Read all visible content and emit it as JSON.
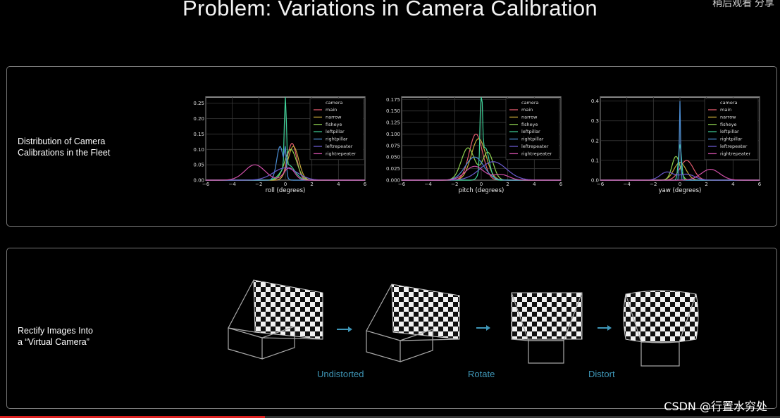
{
  "slide": {
    "title": "Problem: Variations in Camera Calibration",
    "top_right": "稍后观看 分享"
  },
  "section1": {
    "label_line1": "Distribution of Camera",
    "label_line2": "Calibrations in the Fleet"
  },
  "section2": {
    "label_line1": "Rectify Images Into",
    "label_line2": "a “Virtual Camera”",
    "steps": [
      "Undistorted",
      "Rotate",
      "Distort"
    ]
  },
  "watermark": "CSDN @行置水穷处",
  "video": {
    "progress": 0.34
  },
  "legend_title": "camera",
  "chart_data": [
    {
      "type": "line",
      "xlabel": "roll (degrees)",
      "xlim": [
        -6,
        6
      ],
      "ylim": [
        0,
        0.27
      ],
      "xticks": [
        -6,
        -4,
        -2,
        0,
        2,
        4,
        6
      ],
      "yticks": [
        0.0,
        0.05,
        0.1,
        0.15,
        0.2,
        0.25
      ],
      "legend_title": "camera",
      "series": [
        {
          "name": "main",
          "color": "#e05a6d",
          "peaks": [
            [
              0.5,
              0.12,
              0.35
            ]
          ]
        },
        {
          "name": "narrow",
          "color": "#c5a83a",
          "peaks": [
            [
              0.6,
              0.11,
              0.4
            ]
          ]
        },
        {
          "name": "fisheye",
          "color": "#8fd14f",
          "peaks": [
            [
              0.4,
              0.1,
              0.45
            ]
          ]
        },
        {
          "name": "leftpillar",
          "color": "#3fd39a",
          "peaks": [
            [
              0.0,
              0.26,
              0.07
            ],
            [
              0.2,
              0.05,
              0.5
            ]
          ]
        },
        {
          "name": "rightpillar",
          "color": "#4c8fd6",
          "peaks": [
            [
              -0.4,
              0.11,
              0.25
            ],
            [
              0.0,
              0.08,
              0.07
            ]
          ]
        },
        {
          "name": "leftrepeater",
          "color": "#6a5acd",
          "peaks": [
            [
              0.0,
              0.04,
              0.9
            ]
          ]
        },
        {
          "name": "rightrepeater",
          "color": "#d04fa8",
          "peaks": [
            [
              -2.3,
              0.05,
              0.75
            ],
            [
              0.3,
              0.04,
              0.4
            ]
          ]
        }
      ]
    },
    {
      "type": "line",
      "xlabel": "pitch (degrees)",
      "xlim": [
        -6,
        6
      ],
      "ylim": [
        0,
        0.18
      ],
      "xticks": [
        -6,
        -4,
        -2,
        0,
        2,
        4,
        6
      ],
      "yticks": [
        0.0,
        0.025,
        0.05,
        0.075,
        0.1,
        0.125,
        0.15,
        0.175
      ],
      "legend_title": "camera",
      "series": [
        {
          "name": "main",
          "color": "#e05a6d",
          "peaks": [
            [
              -0.4,
              0.1,
              0.5
            ]
          ]
        },
        {
          "name": "narrow",
          "color": "#c5a83a",
          "peaks": [
            [
              -0.2,
              0.09,
              0.55
            ]
          ]
        },
        {
          "name": "fisheye",
          "color": "#8fd14f",
          "peaks": [
            [
              -1.0,
              0.07,
              0.5
            ],
            [
              0.5,
              0.06,
              0.4
            ]
          ]
        },
        {
          "name": "leftpillar",
          "color": "#3fd39a",
          "peaks": [
            [
              0.0,
              0.18,
              0.08
            ],
            [
              0.3,
              0.07,
              0.3
            ]
          ]
        },
        {
          "name": "rightpillar",
          "color": "#4c8fd6",
          "peaks": [
            [
              -0.5,
              0.05,
              0.7
            ]
          ]
        },
        {
          "name": "leftrepeater",
          "color": "#6a5acd",
          "peaks": [
            [
              0.9,
              0.04,
              1.0
            ]
          ]
        },
        {
          "name": "rightrepeater",
          "color": "#d04fa8",
          "peaks": [
            [
              1.5,
              0.012,
              0.6
            ],
            [
              -0.5,
              0.03,
              0.7
            ]
          ]
        }
      ]
    },
    {
      "type": "line",
      "xlabel": "yaw (degrees)",
      "xlim": [
        -6,
        6
      ],
      "ylim": [
        0,
        0.42
      ],
      "xticks": [
        -6,
        -4,
        -2,
        0,
        2,
        4,
        6
      ],
      "yticks": [
        0.0,
        0.1,
        0.2,
        0.3,
        0.4
      ],
      "legend_title": "camera",
      "series": [
        {
          "name": "main",
          "color": "#e05a6d",
          "peaks": [
            [
              0.5,
              0.1,
              0.5
            ]
          ]
        },
        {
          "name": "narrow",
          "color": "#c5a83a",
          "peaks": [
            [
              0.0,
              0.09,
              0.45
            ]
          ]
        },
        {
          "name": "fisheye",
          "color": "#8fd14f",
          "peaks": [
            [
              -0.3,
              0.12,
              0.3
            ]
          ]
        },
        {
          "name": "leftpillar",
          "color": "#3fd39a",
          "peaks": [
            [
              0.0,
              0.18,
              0.12
            ]
          ]
        },
        {
          "name": "rightpillar",
          "color": "#4c8fd6",
          "peaks": [
            [
              0.0,
              0.4,
              0.05
            ]
          ]
        },
        {
          "name": "leftrepeater",
          "color": "#6a5acd",
          "peaks": [
            [
              -1.0,
              0.04,
              0.5
            ],
            [
              0.5,
              0.03,
              0.6
            ]
          ]
        },
        {
          "name": "rightrepeater",
          "color": "#d04fa8",
          "peaks": [
            [
              2.3,
              0.055,
              0.7
            ]
          ]
        }
      ]
    }
  ]
}
